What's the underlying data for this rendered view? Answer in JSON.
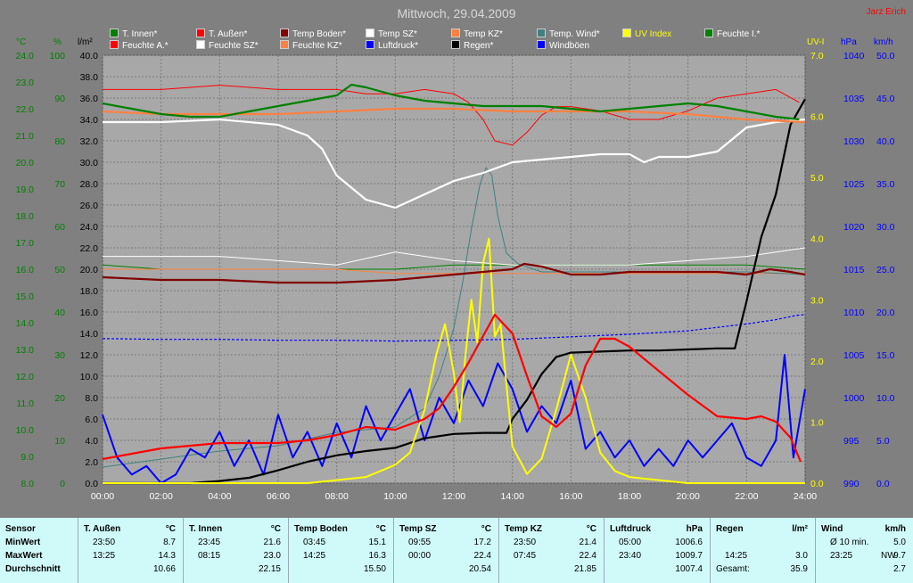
{
  "title": "Mittwoch, 29.04.2009",
  "author": "Jarz Erich",
  "colors": {
    "bg": "#808080",
    "plot": "#a8a8a8",
    "grid": "#7a7a7a",
    "t_innen": "#008000",
    "t_aussen": "#ff0000",
    "temp_boden": "#800000",
    "temp_sz": "#ffffff",
    "temp_kz": "#ff8040",
    "temp_wind": "#408080",
    "uv": "#ffff00",
    "feuchte_i": "#008000",
    "feuchte_a": "#ff0000",
    "feuchte_sz": "#ffffff",
    "feuchte_kz": "#ff8040",
    "luftdruck": "#0000ff",
    "regen": "#000000",
    "windboeen": "#0000ff"
  },
  "legend": [
    {
      "label": "T. Innen*",
      "color": "#008000"
    },
    {
      "label": "T. Außen*",
      "color": "#ff0000"
    },
    {
      "label": "Temp Boden*",
      "color": "#800000"
    },
    {
      "label": "Temp SZ*",
      "color": "#ffffff"
    },
    {
      "label": "Temp KZ*",
      "color": "#ff8040"
    },
    {
      "label": "Temp. Wind*",
      "color": "#408080"
    },
    {
      "label": "UV Index",
      "color": "#ffff00",
      "text_color": "#ffff00"
    },
    {
      "label": "Feuchte I.*",
      "color": "#008000"
    },
    {
      "label": "Feuchte A.*",
      "color": "#ff0000"
    },
    {
      "label": "Feuchte SZ*",
      "color": "#ffffff"
    },
    {
      "label": "Feuchte KZ*",
      "color": "#ff8040"
    },
    {
      "label": "Luftdruck*",
      "color": "#0000ff"
    },
    {
      "label": "Regen*",
      "color": "#000000"
    },
    {
      "label": "Windböen",
      "color": "#0000ff"
    }
  ],
  "axis_units": {
    "celsius": "°C",
    "percent": "%",
    "rain": "l/m²",
    "uv": "UV-I",
    "pressure": "hPa",
    "wind": "km/h"
  },
  "chart_data": {
    "type": "line",
    "x_ticks": [
      "00:00",
      "02:00",
      "04:00",
      "06:00",
      "08:00",
      "10:00",
      "12:00",
      "14:00",
      "16:00",
      "18:00",
      "20:00",
      "22:00",
      "24:00"
    ],
    "axes": {
      "celsius": {
        "range": [
          8.0,
          24.0
        ],
        "ticks": [
          "24.0",
          "23.0",
          "22.0",
          "21.0",
          "20.0",
          "19.0",
          "18.0",
          "17.0",
          "16.0",
          "15.0",
          "14.0",
          "13.0",
          "12.0",
          "11.0",
          "10.0",
          "9.0",
          "8.0"
        ]
      },
      "percent": {
        "range": [
          0,
          100
        ],
        "ticks": [
          "100",
          "90",
          "80",
          "70",
          "60",
          "50",
          "40",
          "30",
          "20",
          "10",
          "0"
        ]
      },
      "rain": {
        "range": [
          0.0,
          40.0
        ],
        "ticks": [
          "40.0",
          "38.0",
          "36.0",
          "34.0",
          "32.0",
          "30.0",
          "28.0",
          "26.0",
          "24.0",
          "22.0",
          "20.0",
          "18.0",
          "16.0",
          "14.0",
          "12.0",
          "10.0",
          "8.0",
          "6.0",
          "4.0",
          "2.0",
          "0.0"
        ]
      },
      "uv": {
        "range": [
          0.0,
          7.0
        ],
        "ticks": [
          "7.0",
          "6.0",
          "5.0",
          "4.0",
          "3.0",
          "2.0",
          "1.0",
          "0.0"
        ]
      },
      "pressure": {
        "range": [
          990,
          1040
        ],
        "ticks": [
          "1040",
          "1035",
          "1030",
          "1025",
          "1020",
          "1015",
          "1010",
          "1005",
          "1000",
          "995",
          "990"
        ]
      },
      "wind": {
        "range": [
          0.0,
          50.0
        ],
        "ticks": [
          "50.0",
          "45.0",
          "40.0",
          "35.0",
          "30.0",
          "25.0",
          "20.0",
          "15.0",
          "10.0",
          "5.0",
          "0.0"
        ]
      }
    },
    "series": [
      {
        "name": "T. Innen*",
        "axis": "celsius",
        "x": [
          0,
          1,
          2,
          3,
          4,
          5,
          6,
          7,
          8,
          8.5,
          9,
          10,
          11,
          12,
          13,
          14,
          15,
          16,
          17,
          18,
          19,
          20,
          21,
          22,
          23,
          23.8
        ],
        "y": [
          22.2,
          22.0,
          21.8,
          21.7,
          21.7,
          21.9,
          22.1,
          22.3,
          22.5,
          22.9,
          22.8,
          22.5,
          22.3,
          22.2,
          22.1,
          22.1,
          22.1,
          22.0,
          21.9,
          22.0,
          22.1,
          22.2,
          22.1,
          21.9,
          21.7,
          21.6
        ]
      },
      {
        "name": "T. Außen*",
        "axis": "celsius",
        "x": [
          0,
          1,
          2,
          3,
          4,
          5,
          6,
          7,
          8,
          9,
          10,
          11,
          11.5,
          12,
          12.5,
          13,
          13.4,
          14,
          14.5,
          15,
          15.5,
          16,
          16.5,
          17,
          17.5,
          18,
          19,
          20,
          21,
          22,
          22.5,
          23,
          23.5,
          23.85
        ],
        "y": [
          8.9,
          9.1,
          9.3,
          9.4,
          9.5,
          9.5,
          9.5,
          9.6,
          9.8,
          10.1,
          10.0,
          10.4,
          10.8,
          11.6,
          12.5,
          13.5,
          14.3,
          13.6,
          12.0,
          10.5,
          10.1,
          10.6,
          12.4,
          13.4,
          13.4,
          13.1,
          12.2,
          11.3,
          10.5,
          10.4,
          10.5,
          10.3,
          9.7,
          8.8
        ]
      },
      {
        "name": "Temp Boden*",
        "axis": "celsius",
        "x": [
          0,
          2,
          4,
          6,
          8,
          10,
          12,
          13,
          14,
          14.4,
          15,
          16,
          17,
          18,
          19,
          20,
          21,
          22,
          22.8,
          23.5,
          24
        ],
        "y": [
          15.7,
          15.6,
          15.6,
          15.5,
          15.5,
          15.6,
          15.8,
          15.9,
          16.0,
          16.2,
          16.1,
          15.8,
          15.8,
          15.9,
          15.9,
          15.9,
          15.9,
          15.8,
          16.0,
          15.9,
          15.8
        ]
      },
      {
        "name": "Temp SZ*",
        "axis": "celsius",
        "x": [
          0,
          2,
          4,
          6,
          7,
          7.5,
          8,
          9,
          10,
          11,
          12,
          13,
          14,
          15,
          16,
          17,
          18,
          18.5,
          19,
          20,
          21,
          22,
          23,
          24
        ],
        "y": [
          21.5,
          21.5,
          21.6,
          21.4,
          21.0,
          20.5,
          19.5,
          18.6,
          18.3,
          18.8,
          19.3,
          19.6,
          20.0,
          20.1,
          20.2,
          20.3,
          20.3,
          20.0,
          20.2,
          20.2,
          20.4,
          21.3,
          21.5,
          21.6
        ]
      },
      {
        "name": "Temp KZ*",
        "axis": "celsius",
        "x": [
          0,
          2,
          4,
          6,
          8,
          10,
          12,
          14,
          16,
          18,
          20,
          22,
          24
        ],
        "y": [
          21.9,
          21.8,
          21.8,
          21.8,
          21.9,
          22.0,
          22.0,
          21.9,
          21.9,
          21.9,
          21.8,
          21.6,
          21.5
        ]
      },
      {
        "name": "Temp. Wind*",
        "axis": "celsius",
        "x": [
          0,
          2,
          4,
          6,
          8,
          10,
          11,
          11.5,
          12,
          12.3,
          12.6,
          12.9,
          13.1,
          13.3,
          13.5,
          13.8,
          14.2,
          15,
          16,
          18,
          20,
          22,
          24
        ],
        "y": [
          8.6,
          8.9,
          9.2,
          9.4,
          9.9,
          10.1,
          10.8,
          12.0,
          13.8,
          15.5,
          17.5,
          19.2,
          19.8,
          19.5,
          18.0,
          16.6,
          16.2,
          15.9,
          15.9,
          15.9,
          15.9,
          15.9,
          15.8
        ]
      },
      {
        "name": "Feuchte I.*",
        "axis": "percent",
        "x": [
          0,
          2,
          4,
          6,
          8,
          10,
          12,
          14,
          16,
          18,
          20,
          22,
          24
        ],
        "y": [
          51,
          50,
          50,
          50,
          50,
          50,
          51,
          51,
          51,
          51,
          51,
          51,
          50
        ]
      },
      {
        "name": "Feuchte A.*",
        "axis": "percent",
        "x": [
          0,
          2,
          4,
          6,
          8,
          9,
          10,
          11,
          12,
          12.5,
          13,
          13.4,
          14,
          14.5,
          15,
          15.5,
          16,
          17,
          18,
          19,
          20,
          21,
          22,
          23,
          23.8
        ],
        "y": [
          92,
          92,
          93,
          92,
          92,
          91,
          91,
          92,
          91,
          89,
          85,
          80,
          79,
          82,
          86,
          88,
          88,
          87,
          85,
          85,
          87,
          90,
          91,
          92,
          89
        ]
      },
      {
        "name": "Feuchte SZ*",
        "axis": "percent",
        "x": [
          0,
          2,
          4,
          6,
          8,
          10,
          12,
          14,
          16,
          18,
          20,
          22,
          24
        ],
        "y": [
          53,
          53,
          53,
          52,
          51,
          54,
          52,
          51,
          51,
          51,
          52,
          53,
          55
        ]
      },
      {
        "name": "Feuchte KZ*",
        "axis": "percent",
        "x": [
          0,
          2,
          4,
          6,
          8,
          10,
          12,
          14,
          16,
          18,
          20,
          22,
          24
        ],
        "y": [
          50,
          50,
          50,
          50,
          50,
          49,
          49,
          49,
          49,
          49,
          49,
          49,
          49
        ]
      },
      {
        "name": "Luftdruck*",
        "axis": "pressure",
        "x": [
          0,
          2,
          4,
          6,
          8,
          10,
          12,
          14,
          16,
          18,
          20,
          22,
          23,
          23.7,
          24
        ],
        "y": [
          1006.9,
          1006.8,
          1006.8,
          1006.7,
          1006.7,
          1006.6,
          1006.7,
          1006.8,
          1007.1,
          1007.4,
          1007.8,
          1008.6,
          1009.1,
          1009.6,
          1009.7
        ]
      },
      {
        "name": "Regen*",
        "axis": "rain",
        "x": [
          0,
          3,
          4,
          5,
          6,
          7,
          8,
          9,
          10,
          11,
          12,
          13,
          13.8,
          14,
          14.5,
          15,
          15.5,
          16,
          17,
          18,
          19,
          20,
          21,
          21.6,
          22,
          22.5,
          23,
          23.5,
          24
        ],
        "y": [
          0,
          0,
          0.2,
          0.5,
          1.2,
          2.0,
          2.6,
          3.0,
          3.3,
          4.2,
          4.6,
          4.7,
          4.7,
          6.0,
          7.8,
          10.2,
          11.8,
          12.2,
          12.3,
          12.4,
          12.4,
          12.5,
          12.6,
          12.6,
          17.0,
          23.0,
          27.0,
          33.5,
          35.9
        ]
      },
      {
        "name": "UV Index",
        "axis": "uv",
        "x": [
          0,
          7,
          8,
          9,
          9.5,
          10,
          10.5,
          11,
          11.4,
          11.7,
          12,
          12.2,
          12.4,
          12.6,
          12.8,
          13,
          13.2,
          13.4,
          13.6,
          14,
          14.5,
          15,
          15.5,
          16,
          16.5,
          17,
          17.5,
          18,
          19,
          20,
          24
        ],
        "y": [
          0,
          0,
          0.05,
          0.1,
          0.2,
          0.3,
          0.5,
          1.2,
          2.1,
          2.6,
          1.8,
          1.0,
          2.1,
          3.0,
          2.3,
          3.6,
          4.0,
          2.4,
          2.6,
          0.6,
          0.15,
          0.4,
          1.2,
          2.1,
          1.4,
          0.5,
          0.2,
          0.1,
          0.05,
          0,
          0
        ]
      },
      {
        "name": "Windböen",
        "axis": "wind",
        "x": [
          0,
          0.5,
          1,
          1.5,
          2,
          2.5,
          3,
          3.5,
          4,
          4.5,
          5,
          5.5,
          6,
          6.5,
          7,
          7.5,
          8,
          8.5,
          9,
          9.5,
          10,
          10.5,
          11,
          11.5,
          12,
          12.5,
          13,
          13.5,
          14,
          14.5,
          15,
          15.5,
          16,
          16.5,
          17,
          17.5,
          18,
          18.5,
          19,
          19.5,
          20,
          20.5,
          21,
          21.5,
          22,
          22.5,
          23,
          23.3,
          23.6,
          24
        ],
        "y": [
          8,
          3,
          1,
          2,
          0,
          1,
          4,
          3,
          6,
          2,
          5,
          1,
          8,
          3,
          6,
          2,
          7,
          3,
          9,
          5,
          8,
          11,
          5,
          10,
          7,
          12,
          9,
          14,
          11,
          6,
          9,
          7,
          12,
          4,
          6,
          3,
          5,
          2,
          4,
          2,
          5,
          3,
          5,
          7,
          3,
          2,
          5,
          15,
          3,
          11
        ]
      }
    ],
    "grid": true,
    "legend_position": "top"
  },
  "stats": {
    "row_labels": [
      "Sensor",
      "MinWert",
      "MaxWert",
      "Durchschnitt"
    ],
    "columns": [
      {
        "name": "T. Außen",
        "unit": "°C",
        "min_time": "23:50",
        "min": "8.7",
        "max_time": "13:25",
        "max": "14.3",
        "avg": "10.66"
      },
      {
        "name": "T. Innen",
        "unit": "°C",
        "min_time": "23:45",
        "min": "21.6",
        "max_time": "08:15",
        "max": "23.0",
        "avg": "22.15"
      },
      {
        "name": "Temp Boden",
        "unit": "°C",
        "min_time": "03:45",
        "min": "15.1",
        "max_time": "14:25",
        "max": "16.3",
        "avg": "15.50"
      },
      {
        "name": "Temp SZ",
        "unit": "°C",
        "min_time": "09:55",
        "min": "17.2",
        "max_time": "00:00",
        "max": "22.4",
        "avg": "20.54"
      },
      {
        "name": "Temp KZ",
        "unit": "°C",
        "min_time": "23:50",
        "min": "21.4",
        "max_time": "07:45",
        "max": "22.4",
        "avg": "21.85"
      },
      {
        "name": "Luftdruck",
        "unit": "hPa",
        "min_time": "05:00",
        "min": "1006.6",
        "max_time": "23:40",
        "max": "1009.7",
        "avg": "1007.4"
      }
    ],
    "regen": {
      "name": "Regen",
      "unit": "l/m²",
      "max_time": "14:25",
      "max": "3.0",
      "total_label": "Gesamt:",
      "total": "35.9"
    },
    "wind": {
      "name": "Wind",
      "unit": "km/h",
      "avg_label": "Ø 10 min.",
      "avg": "5.0",
      "max_time": "23:25",
      "max_dir": "NW",
      "max": "9.7",
      "last": "2.7"
    }
  }
}
